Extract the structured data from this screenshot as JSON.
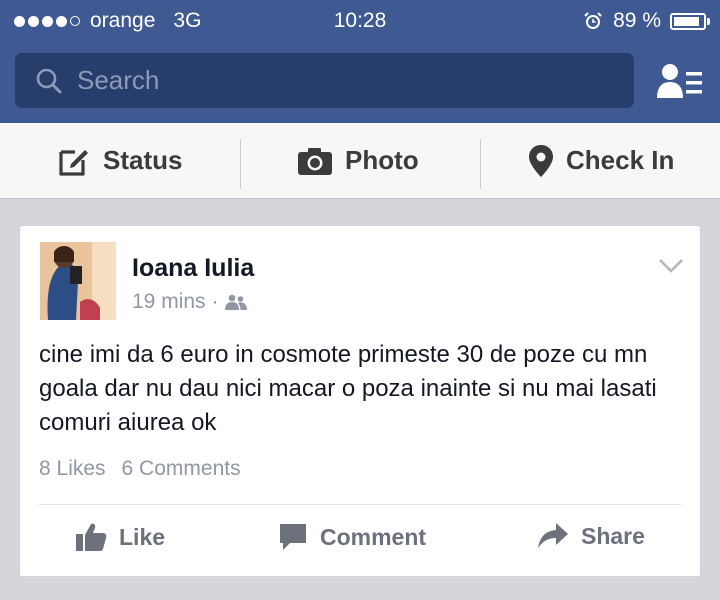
{
  "status_bar": {
    "signal_dots_filled": 4,
    "signal_dots_total": 5,
    "carrier": "orange",
    "network": "3G",
    "time": "10:28",
    "battery_text": "89 %",
    "battery_level": 0.89
  },
  "search": {
    "placeholder": "Search"
  },
  "composer": {
    "status_label": "Status",
    "photo_label": "Photo",
    "checkin_label": "Check In"
  },
  "post": {
    "author": "Ioana Iulia",
    "time": "19 mins",
    "separator": "·",
    "audience_icon": "friends-icon",
    "text": "cine imi da 6 euro in cosmote primeste 30 de poze cu mn goala dar nu dau nici macar o poza inainte si nu mai lasati comuri aiurea ok",
    "likes": "8 Likes",
    "comments": "6 Comments",
    "actions": {
      "like": "Like",
      "comment": "Comment",
      "share": "Share"
    }
  },
  "colors": {
    "header_blue": "#3f5a92",
    "search_bg": "#273d6c",
    "feed_bg": "#d4d6dc"
  }
}
